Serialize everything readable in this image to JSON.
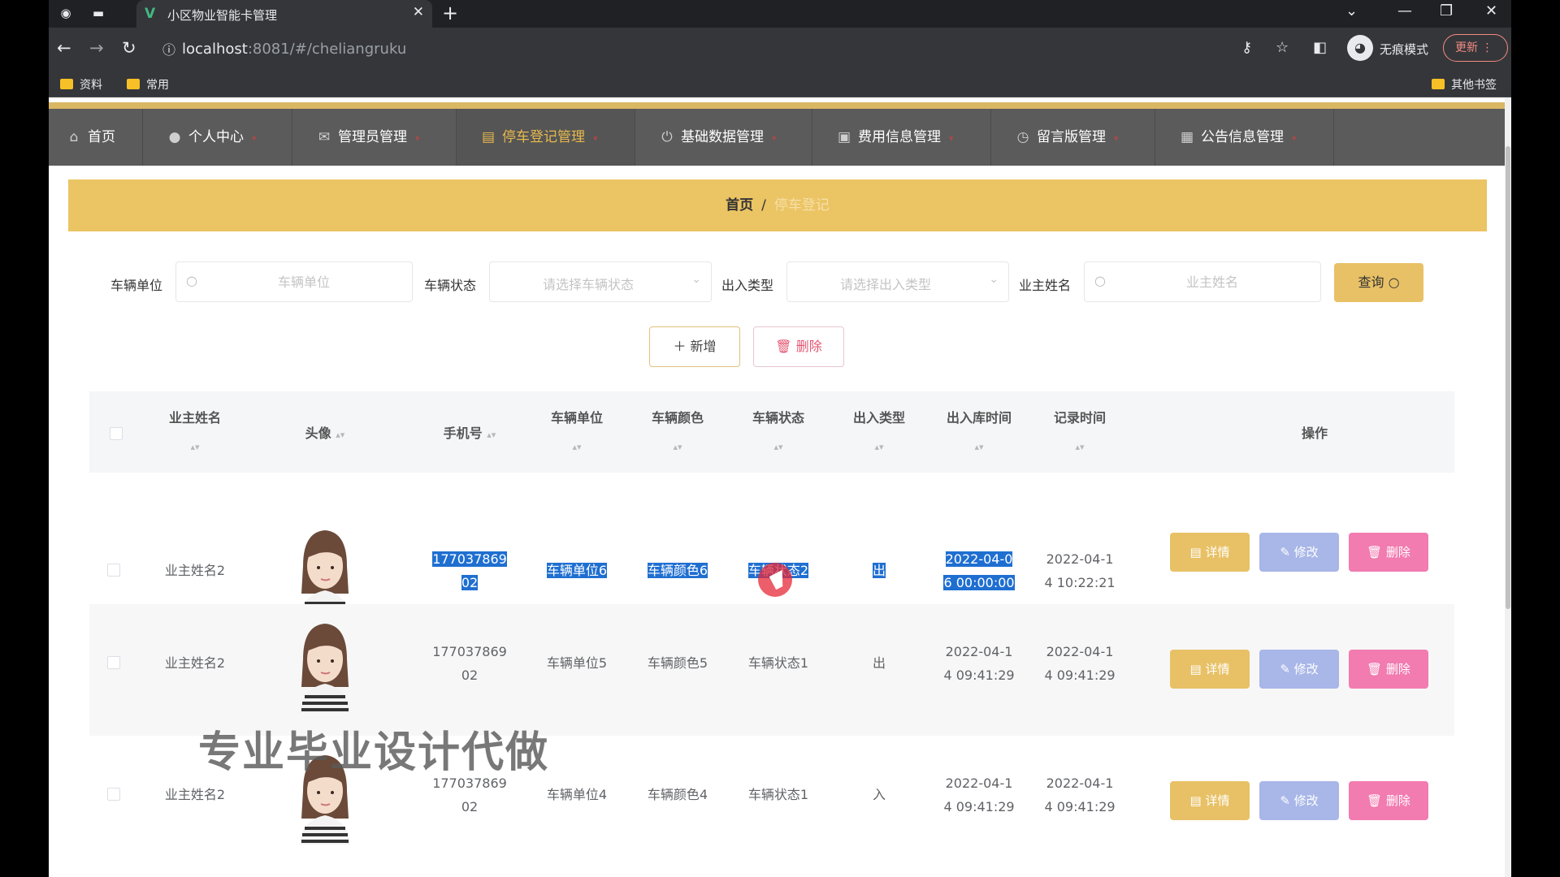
{
  "browser": {
    "tab_title": "小区物业智能卡管理",
    "url_host": "localhost",
    "url_rest": ":8081/#/cheliangruku",
    "incognito_label": "无痕模式",
    "update_label": "更新",
    "bookmarks": [
      "资料",
      "常用"
    ],
    "other_bookmarks": "其他书签"
  },
  "nav": {
    "items": [
      {
        "label": "首页",
        "icon": "home-icon"
      },
      {
        "label": "个人中心",
        "icon": "user-icon"
      },
      {
        "label": "管理员管理",
        "icon": "mail-icon"
      },
      {
        "label": "停车登记管理",
        "icon": "folder-icon",
        "active": true
      },
      {
        "label": "基础数据管理",
        "icon": "power-icon"
      },
      {
        "label": "费用信息管理",
        "icon": "camera-icon"
      },
      {
        "label": "留言版管理",
        "icon": "clock-icon"
      },
      {
        "label": "公告信息管理",
        "icon": "grid-icon"
      }
    ]
  },
  "breadcrumb": {
    "home": "首页",
    "separator": "/",
    "current": "停车登记"
  },
  "filters": {
    "unit_label": "车辆单位",
    "unit_placeholder": "车辆单位",
    "status_label": "车辆状态",
    "status_placeholder": "请选择车辆状态",
    "io_label": "出入类型",
    "io_placeholder": "请选择出入类型",
    "owner_label": "业主姓名",
    "owner_placeholder": "业主姓名",
    "query_label": "查询"
  },
  "actions": {
    "add_label": "新增",
    "delete_label": "删除"
  },
  "table": {
    "columns": [
      "业主姓名",
      "头像",
      "手机号",
      "车辆单位",
      "车辆颜色",
      "车辆状态",
      "出入类型",
      "出入库时间",
      "记录时间",
      "操作"
    ],
    "rows": [
      {
        "owner": "业主姓名2",
        "phone_1": "177037869",
        "phone_2": "02",
        "unit": "车辆单位6",
        "color": "车辆颜色6",
        "status": "车辆状态2",
        "io": "出",
        "io_time_1": "2022-04-0",
        "io_time_2": "6 00:00:00",
        "rec_time_1": "2022-04-1",
        "rec_time_2": "4 10:22:21",
        "selected": true
      },
      {
        "owner": "业主姓名2",
        "phone_1": "177037869",
        "phone_2": "02",
        "unit": "车辆单位5",
        "color": "车辆颜色5",
        "status": "车辆状态1",
        "io": "出",
        "io_time_1": "2022-04-1",
        "io_time_2": "4 09:41:29",
        "rec_time_1": "2022-04-1",
        "rec_time_2": "4 09:41:29"
      },
      {
        "owner": "业主姓名2",
        "phone_1": "177037869",
        "phone_2": "02",
        "unit": "车辆单位4",
        "color": "车辆颜色4",
        "status": "车辆状态1",
        "io": "入",
        "io_time_1": "2022-04-1",
        "io_time_2": "4 09:41:29",
        "rec_time_1": "2022-04-1",
        "rec_time_2": "4 09:41:29"
      }
    ],
    "op_labels": {
      "detail": "详情",
      "edit": "修改",
      "delete": "删除"
    }
  },
  "watermark": "专业毕业设计代做",
  "colors": {
    "accent": "#ebc464",
    "nav_bg": "#5b5b5b",
    "active_nav": "#e8b94d",
    "edit": "#a8b6e8",
    "delete": "#f27bb0",
    "selection": "#1f6fd1"
  }
}
